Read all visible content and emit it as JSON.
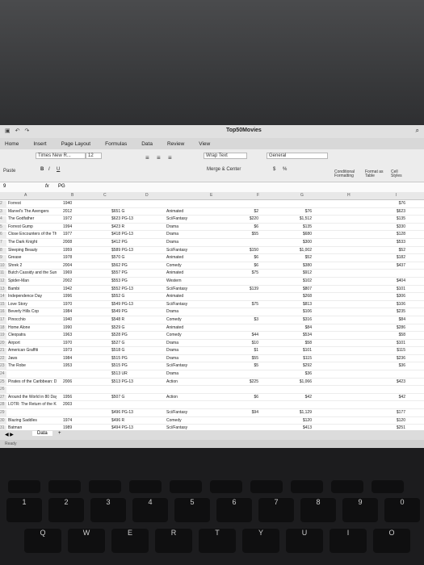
{
  "app": {
    "title": "Top50Movies"
  },
  "tabs": [
    "Home",
    "Insert",
    "Page Layout",
    "Formulas",
    "Data",
    "Review",
    "View"
  ],
  "ribbon": {
    "paste": "Paste",
    "font_name": "Times New R...",
    "font_size": "12",
    "bold": "B",
    "italic": "I",
    "underline": "U",
    "wrap_text": "Wrap Text",
    "merge_center": "Merge & Center",
    "number_format": "General",
    "currency": "$",
    "percent": "%",
    "cond_format": "Conditional Formatting",
    "format_table": "Format as Table",
    "cell_styles": "Cell Styles"
  },
  "formula": {
    "cell_ref": "9",
    "fx": "fx",
    "content": "PG"
  },
  "columns": [
    "A",
    "B",
    "C",
    "D",
    "E",
    "F",
    "G",
    "H",
    "I"
  ],
  "rows": [
    [
      "2",
      "Forrest",
      "1940",
      "",
      "",
      "",
      "",
      "$76"
    ],
    [
      "3",
      "Marvel's The Avengers",
      "2012",
      "$651 G",
      "Animated",
      "$2",
      "$76",
      "$623"
    ],
    [
      "4",
      "The Godfather",
      "1972",
      "$623 PG-13",
      "Sci/Fantasy",
      "$220",
      "$1,512",
      "$135"
    ],
    [
      "5",
      "Forrest Gump",
      "1994",
      "$423 R",
      "Drama",
      "$6",
      "$135",
      "$330"
    ],
    [
      "6",
      "Close Encounters of the Third Kind",
      "1977",
      "$418 PG-13",
      "Drama",
      "$55",
      "$680",
      "$128"
    ],
    [
      "7",
      "The Dark Knight",
      "2008",
      "$412 PG",
      "Drama",
      "",
      "$300",
      "$533"
    ],
    [
      "8",
      "Sleeping Beauty",
      "1959",
      "$589 PG-13",
      "Sci/Fantasy",
      "$150",
      "$1,002",
      "$52"
    ],
    [
      "9",
      "Grease",
      "1978",
      "$570 G",
      "Animated",
      "$6",
      "$52",
      "$182"
    ],
    [
      "10",
      "Shrek 2",
      "2004",
      "$562 PG",
      "Comedy",
      "$6",
      "$380",
      "$437"
    ],
    [
      "11",
      "Butch Cassidy and the Sundance Kid",
      "1969",
      "$557 PG",
      "Animated",
      "$75",
      "$912",
      ""
    ],
    [
      "12",
      "Spider-Man",
      "2002",
      "$553 PG",
      "Western",
      "",
      "$102",
      "$404"
    ],
    [
      "13",
      "Bambi",
      "1942",
      "$552 PG-13",
      "Sci/Fantasy",
      "$139",
      "$807",
      "$101"
    ],
    [
      "14",
      "Independence Day",
      "1996",
      "$552 G",
      "Animated",
      "",
      "$268",
      "$306"
    ],
    [
      "15",
      "Love Story",
      "1970",
      "$549 PG-13",
      "Sci/Fantasy",
      "$75",
      "$813",
      "$106"
    ],
    [
      "16",
      "Beverly Hills Cop",
      "1984",
      "$549 PG",
      "Drama",
      "",
      "$106",
      "$235"
    ],
    [
      "17",
      "Pinocchio",
      "1940",
      "$548 R",
      "Comedy",
      "$3",
      "$316",
      "$84"
    ],
    [
      "18",
      "Home Alone",
      "1990",
      "$529 G",
      "Animated",
      "",
      "$84",
      "$286"
    ],
    [
      "19",
      "Cleopatra",
      "1963",
      "$528 PG",
      "Comedy",
      "$44",
      "$534",
      "$58"
    ],
    [
      "20",
      "Airport",
      "1970",
      "$527 G",
      "Drama",
      "$10",
      "$58",
      "$101"
    ],
    [
      "21",
      "American Graffiti",
      "1973",
      "$518 G",
      "Drama",
      "$1",
      "$101",
      "$115"
    ],
    [
      "22",
      "Jaws",
      "1984",
      "$515 PG",
      "Drama",
      "$55",
      "$115",
      "$236"
    ],
    [
      "23",
      "The Robe",
      "1953",
      "$515 PG",
      "Sci/Fantasy",
      "$5",
      "$292",
      "$36"
    ],
    [
      "24",
      "",
      "",
      "$513 UR",
      "Drama",
      "",
      "$36",
      ""
    ],
    [
      "25",
      "Pirates of the Caribbean: Dead Man's Chest",
      "2006",
      "$513 PG-13",
      "Action",
      "$225",
      "$1,066",
      "$423"
    ],
    [
      "26",
      "",
      "",
      "",
      "",
      "",
      "",
      ""
    ],
    [
      "27",
      "Around the World in 80 Days",
      "1956",
      "$507 G",
      "Action",
      "$6",
      "$42",
      "$42"
    ],
    [
      "28",
      "LOTR: The Return of the King",
      "2003",
      "",
      "",
      "",
      "",
      ""
    ],
    [
      "29",
      "",
      "",
      "$496 PG-13",
      "Sci/Fantasy",
      "$94",
      "$1,129",
      "$177"
    ],
    [
      "30",
      "Blazing Saddles",
      "1974",
      "$496 R",
      "Comedy",
      "",
      "$120",
      "$120"
    ],
    [
      "31",
      "Batman",
      "1989",
      "$494 PG-13",
      "Sci/Fantasy",
      "",
      "$413",
      "$251"
    ],
    [
      "32",
      "",
      "",
      "",
      "",
      "",
      "",
      ""
    ],
    [
      "33",
      "",
      "",
      "",
      "",
      "",
      "",
      ""
    ]
  ],
  "sheet": {
    "name": "Data",
    "add": "+"
  },
  "status": {
    "ready": "Ready"
  },
  "keyboard": {
    "numbers": [
      "1",
      "2",
      "3",
      "4",
      "5",
      "6",
      "7",
      "8",
      "9",
      "0"
    ],
    "letters": [
      "Q",
      "W",
      "E",
      "R",
      "T",
      "Y",
      "U",
      "I",
      "O"
    ]
  }
}
